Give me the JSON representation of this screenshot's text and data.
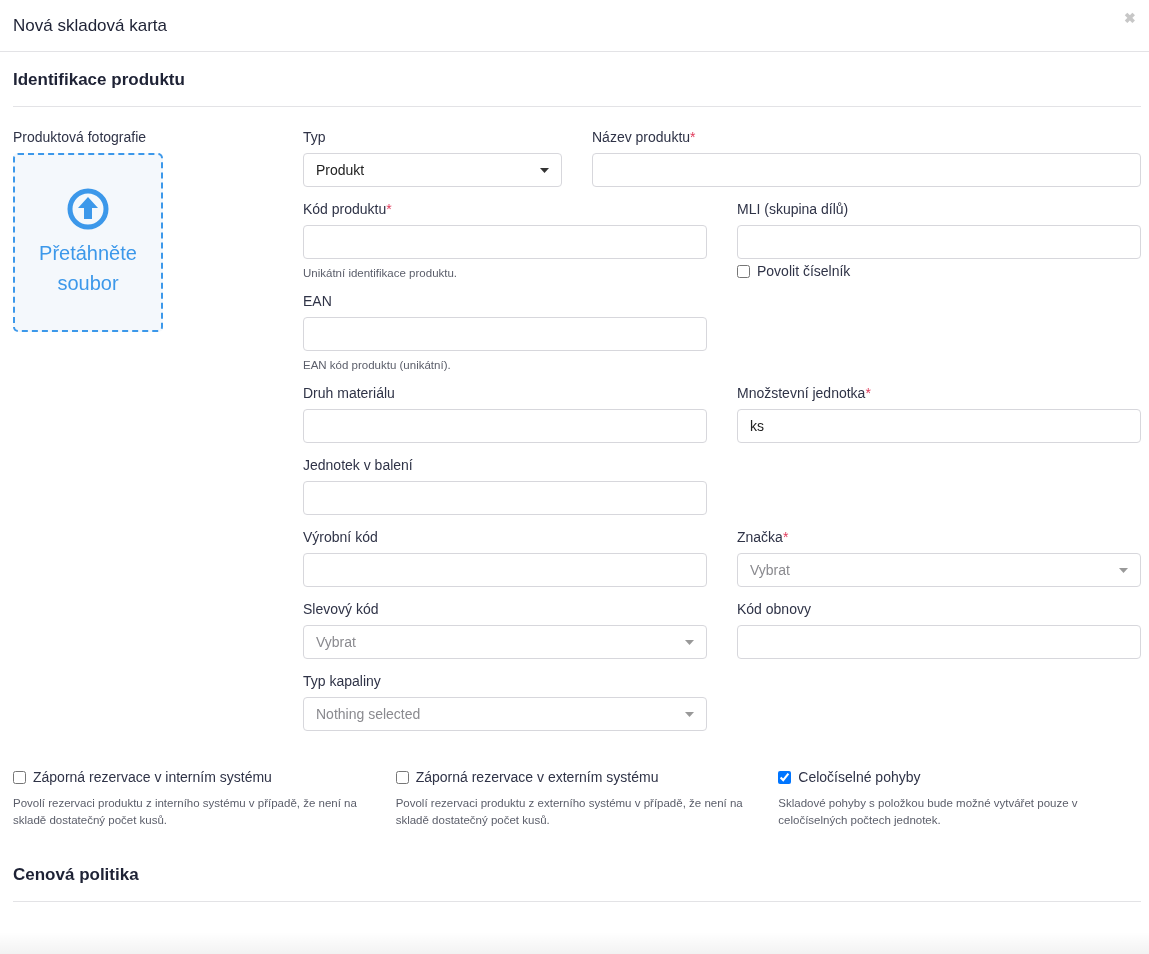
{
  "window": {
    "title": "Nová skladová karta",
    "close": "✖"
  },
  "sections": [
    {
      "title": "Identifikace produktu"
    },
    {
      "title": "Cenová politika"
    }
  ],
  "photo": {
    "label": "Produktová fotografie",
    "dropzone_text": "Přetáhněte soubor"
  },
  "top_row": {
    "left": {
      "kind": "select",
      "label": "Typ",
      "value": "Produkt"
    },
    "right": {
      "kind": "text",
      "label": "Název produktu",
      "required_mark": "*"
    }
  },
  "rows": [
    {
      "left": {
        "kind": "text",
        "label": "Kód produktu",
        "required_mark": "*",
        "help": "Unikátní identifikace produktu."
      },
      "right": {
        "kind": "text",
        "label": "MLI (skupina dílů)",
        "checkbox": {
          "label": "Povolit číselník",
          "checked": false
        }
      }
    },
    {
      "left": {
        "kind": "text",
        "label": "EAN",
        "help": "EAN kód produktu (unikátní)."
      }
    },
    {
      "left": {
        "kind": "text",
        "label": "Druh materiálu"
      },
      "right": {
        "kind": "text",
        "label": "Množstevní jednotka",
        "required_mark": "*",
        "value": "ks"
      }
    },
    {
      "left": {
        "kind": "text",
        "label": "Jednotek v balení"
      }
    },
    {
      "left": {
        "kind": "text",
        "label": "Výrobní kód"
      },
      "right": {
        "kind": "select",
        "label": "Značka",
        "required_mark": "*",
        "placeholder": "Vybrat"
      }
    },
    {
      "left": {
        "kind": "select",
        "label": "Slevový kód",
        "placeholder": "Vybrat"
      },
      "right": {
        "kind": "text",
        "label": "Kód obnovy"
      }
    },
    {
      "left": {
        "kind": "select",
        "label": "Typ kapaliny",
        "placeholder": "Nothing selected"
      }
    }
  ],
  "options": [
    {
      "label": "Záporná rezervace v interním systému",
      "checked": false,
      "description": "Povolí rezervaci produktu z interního systému v případě, že není na skladě dostatečný počet kusů."
    },
    {
      "label": "Záporná rezervace v externím systému",
      "checked": false,
      "description": "Povolí rezervaci produktu z externího systému v případě, že není na skladě dostatečný počet kusů."
    },
    {
      "label": "Celočíselné pohyby",
      "checked": true,
      "description": "Skladové pohyby s položkou bude možné vytvářet pouze v celočíselných počtech jednotek."
    }
  ]
}
